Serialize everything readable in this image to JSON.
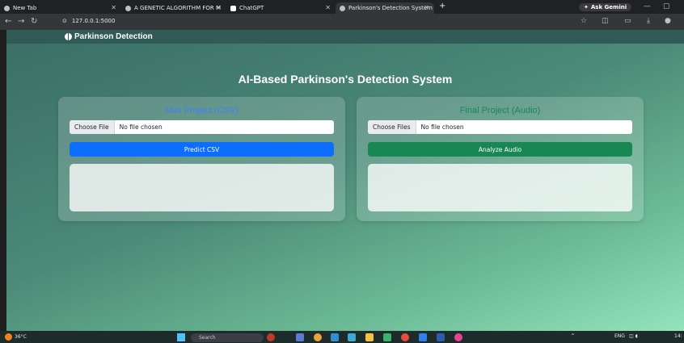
{
  "browser": {
    "tabs": [
      {
        "title": "New Tab"
      },
      {
        "title": "A GENETIC ALGORITHM FOR M"
      },
      {
        "title": "ChatGPT"
      },
      {
        "title": "Parkinson's Detection System"
      }
    ],
    "new_tab_symbol": "+",
    "gemini_label": "Ask Gemini",
    "url": "127.0.0.1:5000"
  },
  "app": {
    "brand": "Parkinson Detection",
    "heading": "AI-Based Parkinson's Detection System",
    "cards": [
      {
        "title": "Mini Project (CSV)",
        "file_button": "Choose File",
        "file_status": "No file chosen",
        "action": "Predict CSV",
        "title_color": "#3b82f6",
        "button_color": "#0d6efd"
      },
      {
        "title": "Final Project (Audio)",
        "file_button": "Choose Files",
        "file_status": "No file chosen",
        "action": "Analyze Audio",
        "title_color": "#198754",
        "button_color": "#198754"
      }
    ]
  },
  "taskbar": {
    "temperature": "36°C",
    "search_placeholder": "Search",
    "language": "ENG",
    "time": "14:"
  }
}
